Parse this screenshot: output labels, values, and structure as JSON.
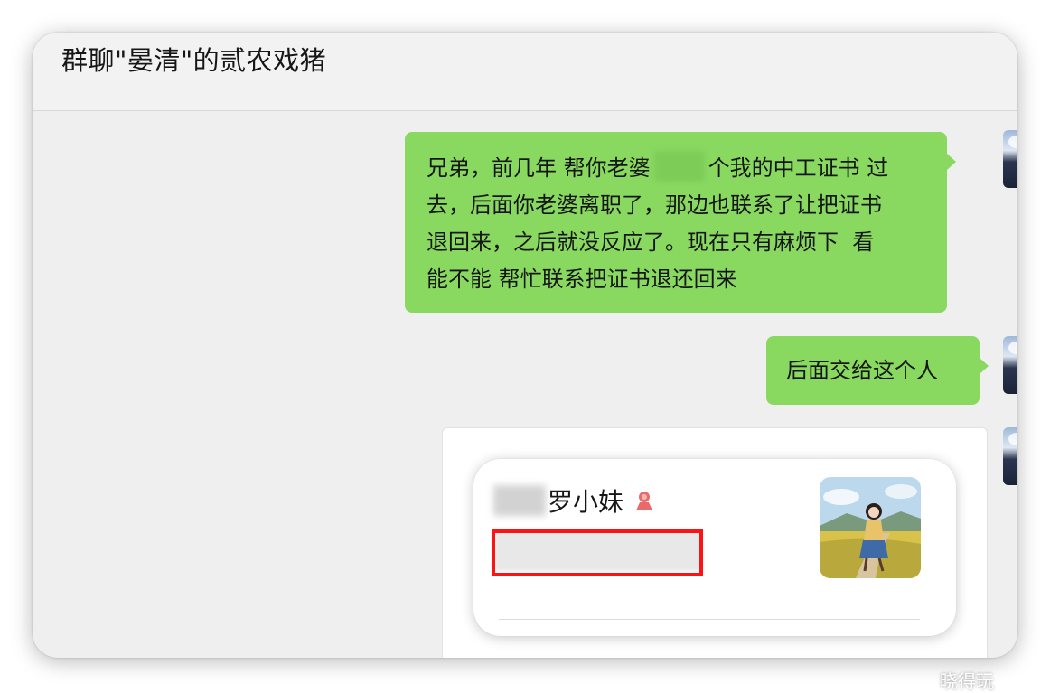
{
  "header": {
    "title": "群聊\"晏清\"的贰农戏猪"
  },
  "messages": [
    {
      "type": "text",
      "sender": "self",
      "segments": [
        "兄弟，前几年 帮你老婆",
        "个我的中工证书 过\n去，后面你老婆离职了，那边也联系了让把证书\n退回来，之后就没反应了。现在只有麻烦下  看\n能不能 帮忙联系把证书退还回来"
      ]
    },
    {
      "type": "text",
      "sender": "self",
      "text": "后面交给这个人"
    },
    {
      "type": "contact_card",
      "sender": "self",
      "name_visible": "罗小妹",
      "gender_icon": "female-icon"
    }
  ],
  "watermark": {
    "text": "晓得玩"
  },
  "colors": {
    "bubble_self": "#89d961",
    "highlight_box": "#ff1212",
    "gender_female": "#e86a6a"
  }
}
